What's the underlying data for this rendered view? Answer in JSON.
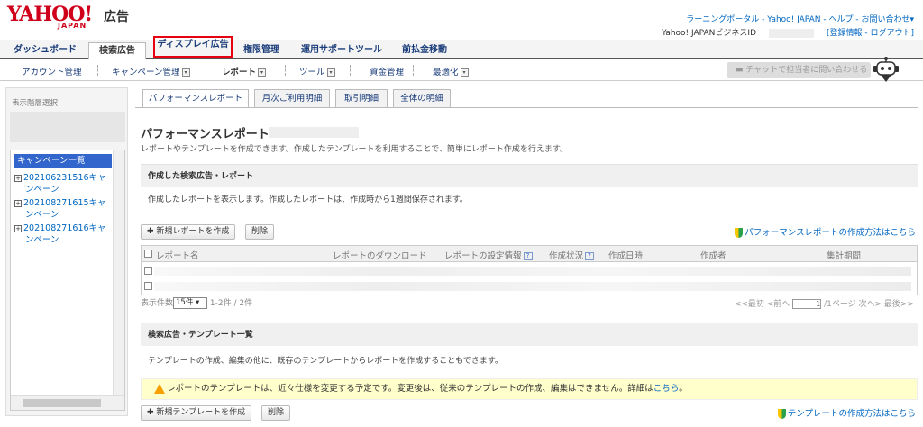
{
  "header": {
    "logo": "YAHOO!",
    "logo_sub": "JAPAN",
    "logo_ad": "広告",
    "links": "ラーニングポータル - Yahoo! JAPAN - ヘルプ - お問い合わせ▾",
    "biz_id_label": "Yahoo! JAPANビジネスID",
    "account_links": "[登録情報 - ログアウト]"
  },
  "main_tabs": [
    {
      "label": "ダッシュボード"
    },
    {
      "label": "検索広告"
    },
    {
      "label": "ディスプレイ広告"
    },
    {
      "label": "権限管理"
    },
    {
      "label": "運用サポートツール"
    },
    {
      "label": "前払金移動"
    }
  ],
  "sub_menu": {
    "account": "アカウント管理",
    "campaign": "キャンペーン管理",
    "report": "レポート",
    "tools": "ツール",
    "funds": "資金管理",
    "optimize": "最適化",
    "chat": "チャットで担当者に問い合わせる"
  },
  "sidebar": {
    "title": "表示階層選択",
    "tree_head": "キャンペーン一覧",
    "items": [
      {
        "label1": "202106231516キャ",
        "label2": "ンペーン"
      },
      {
        "label1": "202108271615キャ",
        "label2": "ンペーン"
      },
      {
        "label1": "202108271616キャ",
        "label2": "ンペーン"
      }
    ]
  },
  "content_tabs": [
    {
      "label": "パフォーマンスレポート"
    },
    {
      "label": "月次ご利用明細"
    },
    {
      "label": "取引明細"
    },
    {
      "label": "全体の明細"
    }
  ],
  "page": {
    "title": "パフォーマンスレポート",
    "description": "レポートやテンプレートを作成できます。作成したテンプレートを利用することで、簡単にレポート作成を行えます。"
  },
  "reports_section": {
    "title": "作成した検索広告・レポート",
    "description": "作成したレポートを表示します。作成したレポートは、作成時から1週間保存されます。",
    "new_button": "✚ 新規レポートを作成",
    "delete_button": "削除",
    "help": "パフォーマンスレポートの作成方法はこちら",
    "columns": [
      "レポート名",
      "レポートのダウンロード",
      "レポートの設定情報",
      "作成状況",
      "作成日時",
      "作成者",
      "集計期間"
    ],
    "q_mark": "?",
    "pager_left_label": "表示件数",
    "per_page": "15件",
    "pager_count": "1-2件 / 2件",
    "pager_prev": "<<最初 <前へ",
    "page_value": "1",
    "pager_next": "/1ページ 次へ> 最後>>"
  },
  "templates_section": {
    "title": "検索広告・テンプレート一覧",
    "description": "テンプレートの作成、編集の他に、既存のテンプレートからレポートを作成することもできます。",
    "warning": "レポートのテンプレートは、近々仕様を変更する予定です。変更後は、従来のテンプレートの作成、編集はできません。詳細は",
    "warning_link": "こちら",
    "warning_end": "。",
    "new_button": "✚ 新規テンプレートを作成",
    "delete_button": "削除",
    "help": "テンプレートの作成方法はこちら"
  },
  "colors": {
    "brand_red": "#d0021b",
    "link_blue": "#0066c0",
    "highlight_red": "#e60012"
  }
}
